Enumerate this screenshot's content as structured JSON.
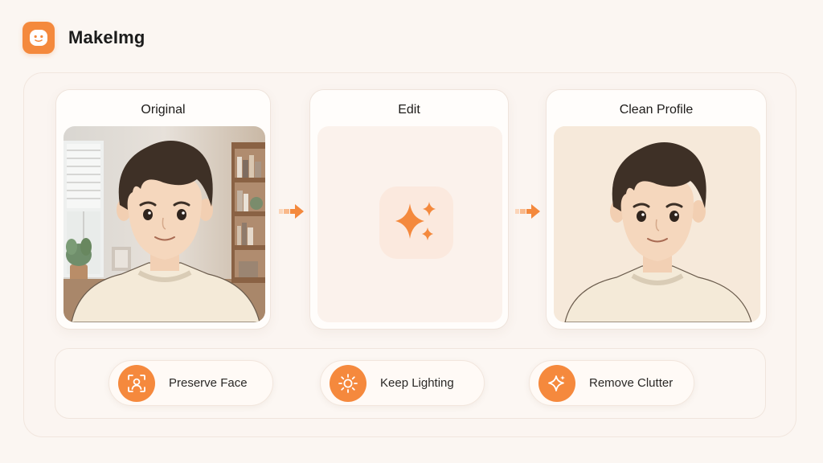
{
  "app": {
    "name": "MakeImg"
  },
  "panels": {
    "original": {
      "title": "Original"
    },
    "edit": {
      "title": "Edit"
    },
    "clean": {
      "title": "Clean Profile"
    }
  },
  "features": [
    {
      "label": "Preserve Face",
      "icon": "face-scan-icon"
    },
    {
      "label": "Keep Lighting",
      "icon": "sun-icon"
    },
    {
      "label": "Remove Clutter",
      "icon": "sparkle-icon"
    }
  ],
  "colors": {
    "accent": "#f4893d",
    "background": "#fbf6f2",
    "tile": "#fbe9de"
  }
}
